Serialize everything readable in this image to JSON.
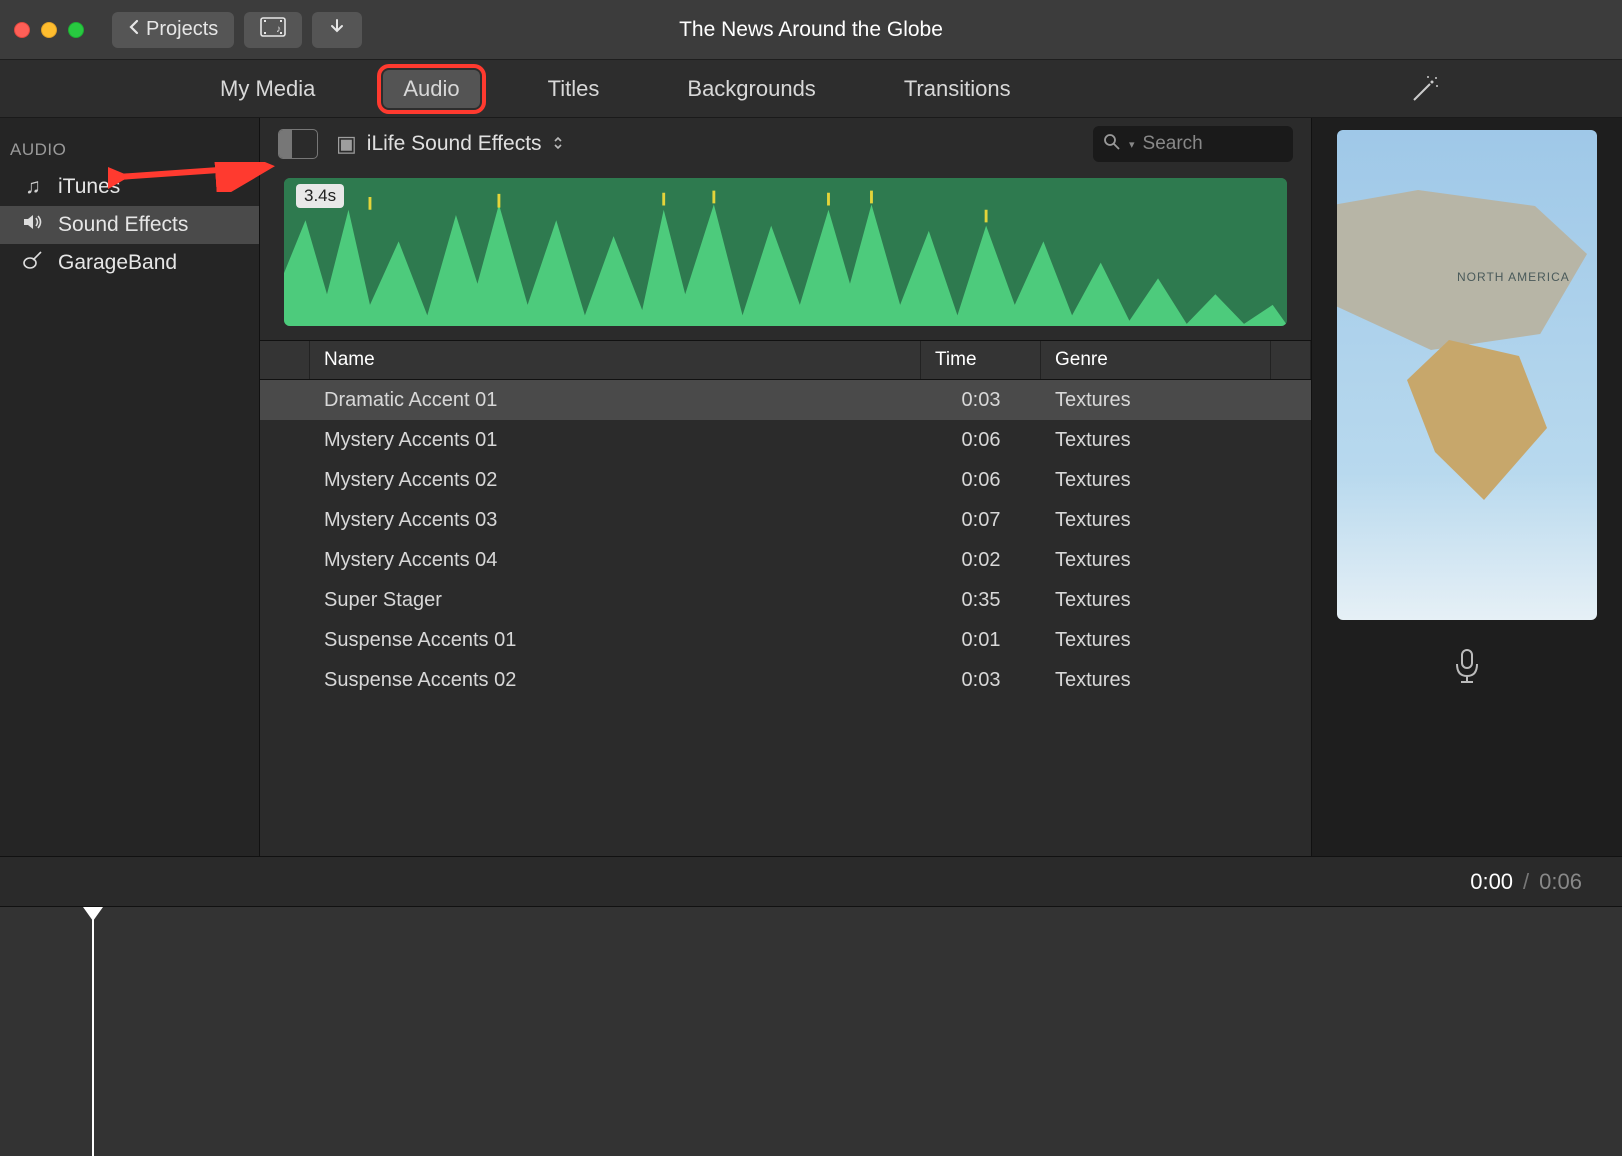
{
  "window": {
    "title": "The News Around the Globe",
    "projects_button": "Projects"
  },
  "tabs": {
    "items": [
      "My Media",
      "Audio",
      "Titles",
      "Backgrounds",
      "Transitions"
    ],
    "active_index": 1
  },
  "sidebar": {
    "header": "AUDIO",
    "items": [
      {
        "icon": "music-note-icon",
        "label": "iTunes"
      },
      {
        "icon": "sound-icon",
        "label": "Sound Effects"
      },
      {
        "icon": "guitar-icon",
        "label": "GarageBand"
      }
    ],
    "selected_index": 1
  },
  "browser": {
    "library_dropdown": "iLife Sound Effects",
    "search_placeholder": "Search",
    "waveform_duration_badge": "3.4s"
  },
  "table": {
    "columns": [
      "Name",
      "Time",
      "Genre"
    ],
    "selected_index": 0,
    "rows": [
      {
        "name": "Dramatic Accent 01",
        "time": "0:03",
        "genre": "Textures"
      },
      {
        "name": "Mystery Accents 01",
        "time": "0:06",
        "genre": "Textures"
      },
      {
        "name": "Mystery Accents 02",
        "time": "0:06",
        "genre": "Textures"
      },
      {
        "name": "Mystery Accents 03",
        "time": "0:07",
        "genre": "Textures"
      },
      {
        "name": "Mystery Accents 04",
        "time": "0:02",
        "genre": "Textures"
      },
      {
        "name": "Super Stager",
        "time": "0:35",
        "genre": "Textures"
      },
      {
        "name": "Suspense Accents 01",
        "time": "0:01",
        "genre": "Textures"
      },
      {
        "name": "Suspense Accents 02",
        "time": "0:03",
        "genre": "Textures"
      }
    ]
  },
  "preview": {
    "map_label": "NORTH AMERICA"
  },
  "playback": {
    "current": "0:00",
    "total": "0:06"
  }
}
